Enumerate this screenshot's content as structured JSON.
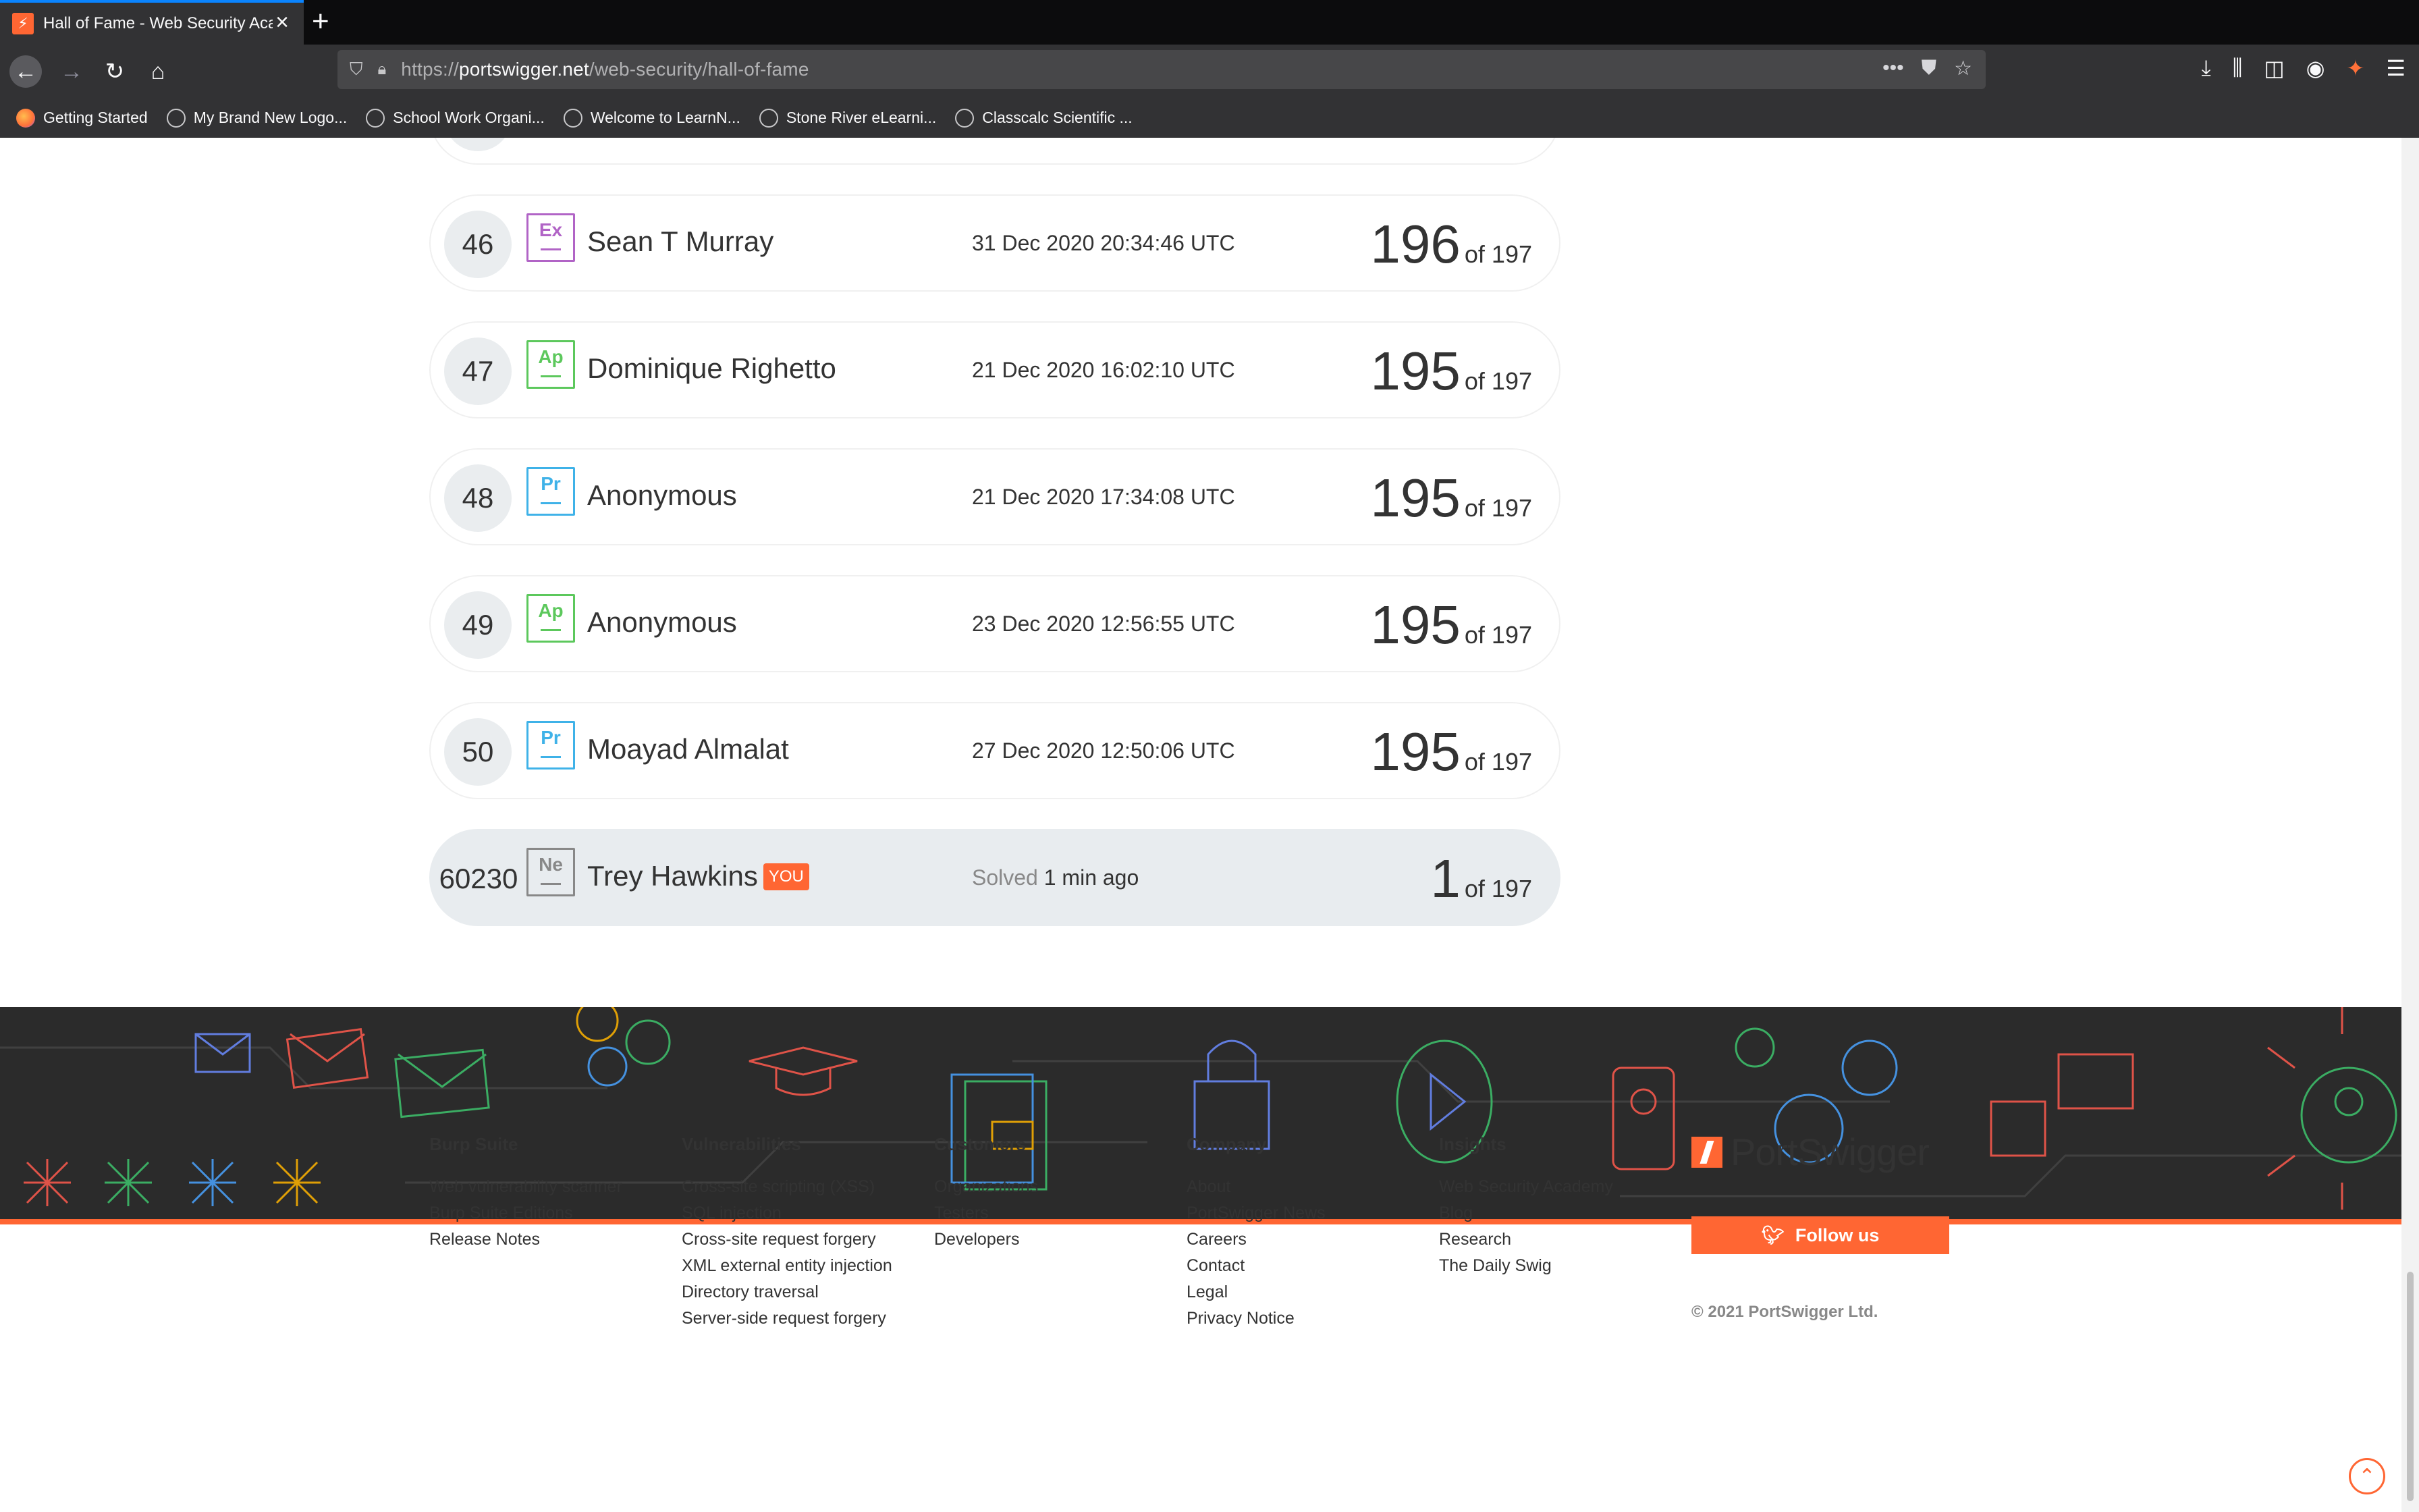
{
  "browser": {
    "tab_title": "Hall of Fame - Web Security Academy",
    "new_tab": "+",
    "close": "×",
    "url_prefix": "https://",
    "url_domain": "portswigger.net",
    "url_path": "/web-security/hall-of-fame",
    "bookmarks": [
      {
        "label": "Getting Started",
        "icon": "firefox-icon"
      },
      {
        "label": "My Brand New Logo...",
        "icon": "globe-icon"
      },
      {
        "label": "School Work Organi...",
        "icon": "globe-icon"
      },
      {
        "label": "Welcome to LearnN...",
        "icon": "globe-icon"
      },
      {
        "label": "Stone River eLearni...",
        "icon": "globe-icon"
      },
      {
        "label": "Classcalc Scientific ...",
        "icon": "globe-icon"
      }
    ]
  },
  "leaderboard": {
    "rows": [
      {
        "rank": "46",
        "badge": "Ex",
        "name": "Sean T Murray",
        "date": "31 Dec 2020 20:34:46 UTC",
        "score": "196",
        "of": "of 197"
      },
      {
        "rank": "47",
        "badge": "Ap",
        "name": "Dominique Righetto",
        "date": "21 Dec 2020 16:02:10 UTC",
        "score": "195",
        "of": "of 197"
      },
      {
        "rank": "48",
        "badge": "Pr",
        "name": "Anonymous",
        "date": "21 Dec 2020 17:34:08 UTC",
        "score": "195",
        "of": "of 197"
      },
      {
        "rank": "49",
        "badge": "Ap",
        "name": "Anonymous",
        "date": "23 Dec 2020 12:56:55 UTC",
        "score": "195",
        "of": "of 197"
      },
      {
        "rank": "50",
        "badge": "Pr",
        "name": "Moayad Almalat",
        "date": "27 Dec 2020 12:50:06 UTC",
        "score": "195",
        "of": "of 197"
      }
    ],
    "me": {
      "rank": "60230",
      "badge": "Ne",
      "name": "Trey Hawkins",
      "you": "YOU",
      "solved_label": "Solved",
      "solved_time": "1 min ago",
      "score": "1",
      "of": "of 197"
    }
  },
  "footer": {
    "columns": [
      {
        "heading": "Burp Suite",
        "links": [
          "Web vulnerability scanner",
          "Burp Suite Editions",
          "Release Notes"
        ]
      },
      {
        "heading": "Vulnerabilities",
        "links": [
          "Cross-site scripting (XSS)",
          "SQL injection",
          "Cross-site request forgery",
          "XML external entity injection",
          "Directory traversal",
          "Server-side request forgery"
        ]
      },
      {
        "heading": "Customers",
        "links": [
          "Organizations",
          "Testers",
          "Developers"
        ]
      },
      {
        "heading": "Company",
        "links": [
          "About",
          "PortSwigger News",
          "Careers",
          "Contact",
          "Legal",
          "Privacy Notice"
        ]
      },
      {
        "heading": "Insights",
        "links": [
          "Web Security Academy",
          "Blog",
          "Research",
          "The Daily Swig"
        ]
      }
    ],
    "brand": "PortSwigger",
    "follow_label": "Follow us",
    "copyright": "© 2021 PortSwigger Ltd."
  },
  "colors": {
    "accent": "#ff6633",
    "expert": "#b164c6",
    "apprentice": "#5cc85c",
    "practitioner": "#3fb2e8",
    "newcomer": "#888888"
  }
}
